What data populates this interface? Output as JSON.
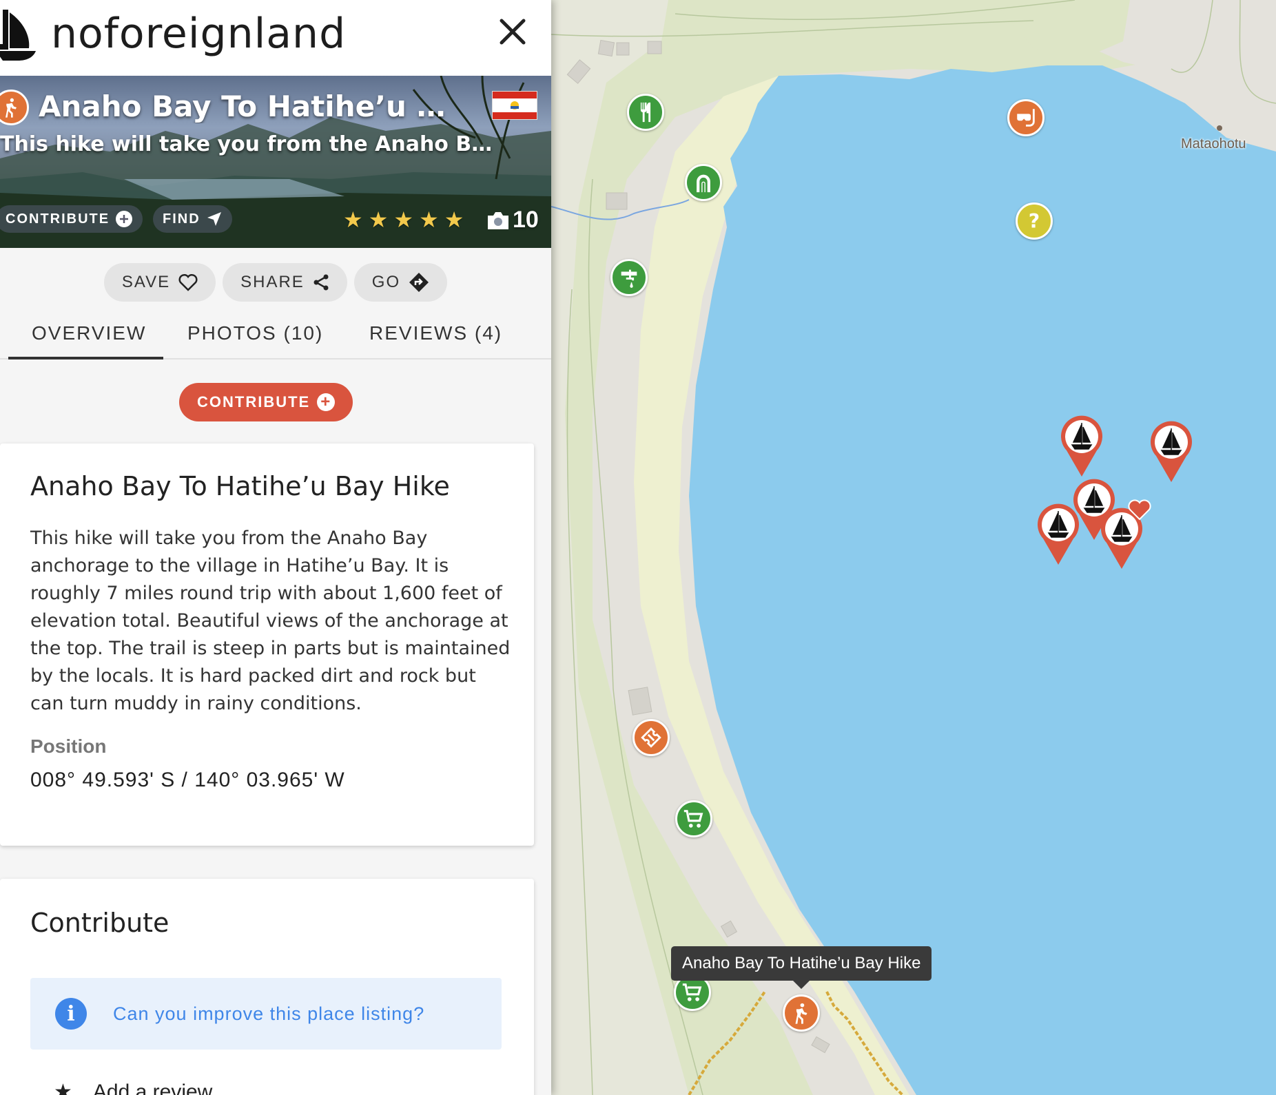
{
  "header": {
    "brand": "noforeignland",
    "close_icon": "close-icon"
  },
  "hero": {
    "title": "Anaho Bay To Hatihe’u Bay Hike",
    "subtitle": "This hike will take you from the Anaho Bay anchorage to the village in Hatihe’u Bay.",
    "contribute_label": "CONTRIBUTE",
    "find_label": "FIND",
    "rating_stars": 5,
    "photo_count": "10",
    "flag": "french-polynesia-flag"
  },
  "actions": {
    "save": "SAVE",
    "share": "SHARE",
    "go": "GO"
  },
  "tabs": [
    {
      "label": "OVERVIEW",
      "active": true
    },
    {
      "label": "PHOTOS (10)",
      "active": false
    },
    {
      "label": "REVIEWS (4)",
      "active": false
    }
  ],
  "contribute_button": "CONTRIBUTE",
  "overview": {
    "title": "Anaho Bay To Hatihe’u Bay Hike",
    "description": "This hike will take you from the Anaho Bay anchorage to the village in Hatihe’u Bay. It is roughly 7 miles round trip with about 1,600 feet of elevation total. Beautiful views of the anchorage at the top. The trail is steep in parts but is maintained by the locals. It is hard packed dirt and rock but can turn muddy in rainy conditions.",
    "position_label": "Position",
    "position_value": "008° 49.593' S / 140° 03.965' W"
  },
  "contribute_card": {
    "title": "Contribute",
    "improve_text": "Can you improve this place listing?",
    "add_review": "Add a review"
  },
  "map": {
    "place_label": "Mataohotu",
    "tooltip": "Anaho Bay To Hatihe’u Bay Hike",
    "colors": {
      "water": "#8ccbed",
      "land": "#dde5c6",
      "shore": "#eef0d0",
      "accent_red": "#d9543e",
      "green_pin": "#3e9c3e",
      "orange_pin": "#e07236"
    }
  }
}
